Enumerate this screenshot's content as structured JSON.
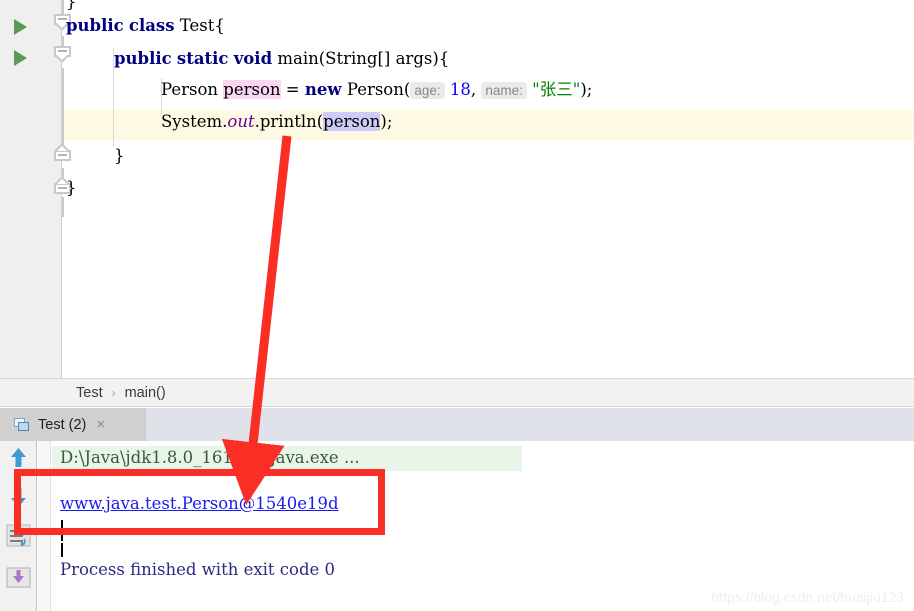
{
  "editor": {
    "lines": [
      {
        "id": "line-partial-top",
        "indent": 0,
        "text": "}"
      },
      {
        "id": "line-class-decl",
        "keyword1": "public",
        "keyword2": "class",
        "name": "Test",
        "brace": "{"
      },
      {
        "id": "line-main-decl",
        "keyword1": "public",
        "keyword2": "static",
        "keyword3": "void",
        "name": "main",
        "params": "(String[] args)",
        "brace": "{"
      },
      {
        "id": "line-person-new",
        "type": "Person",
        "var": "person",
        "eq": "=",
        "keyword": "new",
        "ctor": "Person(",
        "hint_age": "age:",
        "value_age": "18",
        "comma": ",",
        "hint_name": "name:",
        "value_name": "\"张三\"",
        "tail": ");"
      },
      {
        "id": "line-println",
        "prefix": "System.",
        "field": "out",
        "mid": ".println(",
        "arg": "person",
        "tail": ");"
      },
      {
        "id": "line-close-method",
        "text": "}"
      },
      {
        "id": "line-close-class",
        "text": "}"
      }
    ],
    "gutter": {
      "run_method_icon": "run-triangle-icon",
      "run_class_icon": "run-triangle-icon",
      "fold_icon": "fold-minus-icon"
    }
  },
  "breadcrumb": {
    "items": [
      "Test",
      "main()"
    ],
    "separator": "›"
  },
  "run_window": {
    "tab": {
      "label": "Test (2)",
      "close_label": "×",
      "icon": "run-configuration-icon"
    },
    "toolbar": [
      {
        "name": "scroll-up-button",
        "icon": "arrow-up-icon"
      },
      {
        "name": "scroll-down-button",
        "icon": "arrow-down-icon"
      },
      {
        "name": "soft-wrap-button",
        "icon": "soft-wrap-icon"
      },
      {
        "name": "print-export-button",
        "icon": "export-down-icon"
      }
    ],
    "console": {
      "command_line": "D:\\Java\\jdk1.8.0_161\\bin\\java.exe ...",
      "output_link": "www.java.test.Person@1540e19d",
      "exit_line": "Process finished with exit code 0"
    }
  },
  "annotations": {
    "arrow": "red-arrow-annotation",
    "highlight_box": "red-rectangle-annotation"
  },
  "watermark": {
    "text": "https://blog.csdn.net/huaijiu123"
  },
  "colors": {
    "keyword": "#000080",
    "string": "#008000",
    "number": "#0000ff",
    "static_field": "#660099",
    "annotation_red": "#fb2e26",
    "current_line": "#fdf9e3",
    "command_bg": "#e8f5e8",
    "link": "#1a1aee"
  }
}
